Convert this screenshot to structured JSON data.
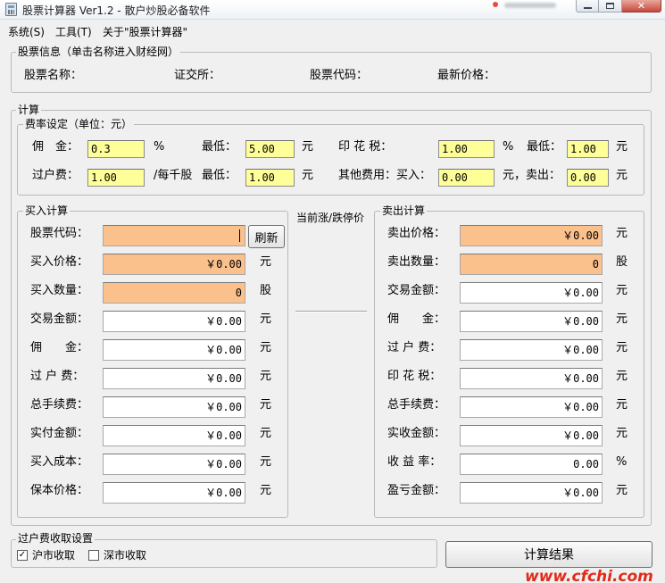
{
  "window": {
    "title": "股票计算器 Ver1.2 - 散户炒股必备软件",
    "buttons": {
      "minimize": "minimize",
      "maximize": "maximize",
      "close": "✕"
    }
  },
  "menu": [
    "系统(S)",
    "工具(T)",
    "关于\"股票计算器\""
  ],
  "stock_info": {
    "title": "股票信息（单击名称进入财经网）",
    "name_label": "股票名称：",
    "exchange_label": "证交所：",
    "code_label": "股票代码：",
    "price_label": "最新价格："
  },
  "calc": {
    "title": "计算",
    "fees": {
      "title": "费率设定（单位：元）",
      "commission_label": "佣　金：",
      "commission_value": "0.3",
      "commission_unit": "%",
      "commission_min_label": "最低：",
      "commission_min_value": "5.00",
      "commission_min_unit": "元",
      "stamp_label": "印 花 税：",
      "stamp_value": "1.00",
      "stamp_unit": "%",
      "stamp_min_label": "最低：",
      "stamp_min_value": "1.00",
      "stamp_min_unit": "元",
      "transfer_label": "过户费：",
      "transfer_value": "1.00",
      "transfer_unit": "/每千股",
      "transfer_min_label": "最低：",
      "transfer_min_value": "1.00",
      "transfer_min_unit": "元",
      "other_label": "其他费用：买入：",
      "other_buy_value": "0.00",
      "other_sell_label": "元，卖出：",
      "other_sell_value": "0.00",
      "other_unit": "元"
    },
    "limit_label": "当前涨/跌停价",
    "buy": {
      "title": "买入计算",
      "refresh_label": "刷新",
      "rows": [
        {
          "label": "股票代码：",
          "value": "",
          "unit": "",
          "style": "o"
        },
        {
          "label": "买入价格：",
          "value": "￥0.00",
          "unit": "元",
          "style": "o"
        },
        {
          "label": "买入数量：",
          "value": "0",
          "unit": "股",
          "style": "o"
        },
        {
          "label": "交易金额：",
          "value": "￥0.00",
          "unit": "元",
          "style": "w"
        },
        {
          "label": "佣　　金：",
          "value": "￥0.00",
          "unit": "元",
          "style": "w"
        },
        {
          "label": "过 户 费：",
          "value": "￥0.00",
          "unit": "元",
          "style": "w"
        },
        {
          "label": "总手续费：",
          "value": "￥0.00",
          "unit": "元",
          "style": "w"
        },
        {
          "label": "实付金额：",
          "value": "￥0.00",
          "unit": "元",
          "style": "w"
        },
        {
          "label": "买入成本：",
          "value": "￥0.00",
          "unit": "元",
          "style": "w"
        },
        {
          "label": "保本价格：",
          "value": "￥0.00",
          "unit": "元",
          "style": "w"
        }
      ]
    },
    "sell": {
      "title": "卖出计算",
      "rows": [
        {
          "label": "卖出价格：",
          "value": "￥0.00",
          "unit": "元",
          "style": "o"
        },
        {
          "label": "卖出数量：",
          "value": "0",
          "unit": "股",
          "style": "o"
        },
        {
          "label": "交易金额：",
          "value": "￥0.00",
          "unit": "元",
          "style": "w"
        },
        {
          "label": "佣　　金：",
          "value": "￥0.00",
          "unit": "元",
          "style": "w"
        },
        {
          "label": "过 户 费：",
          "value": "￥0.00",
          "unit": "元",
          "style": "w"
        },
        {
          "label": "印 花 税：",
          "value": "￥0.00",
          "unit": "元",
          "style": "w"
        },
        {
          "label": "总手续费：",
          "value": "￥0.00",
          "unit": "元",
          "style": "w"
        },
        {
          "label": "实收金额：",
          "value": "￥0.00",
          "unit": "元",
          "style": "w"
        },
        {
          "label": "收 益 率：",
          "value": "0.00",
          "unit": "%",
          "style": "w"
        },
        {
          "label": "盈亏金额：",
          "value": "￥0.00",
          "unit": "元",
          "style": "w"
        }
      ]
    }
  },
  "transfer_settings": {
    "title": "过户费收取设置",
    "shanghai_label": "沪市收取",
    "shanghai_checked": true,
    "shenzhen_label": "深市收取",
    "shenzhen_checked": false
  },
  "calculate_button": "计算结果",
  "watermark": "www.cfchi.com",
  "colors": {
    "input_yellow": "#ffff99",
    "input_orange": "#fbc18d",
    "watermark_red": "#e22a1a"
  }
}
